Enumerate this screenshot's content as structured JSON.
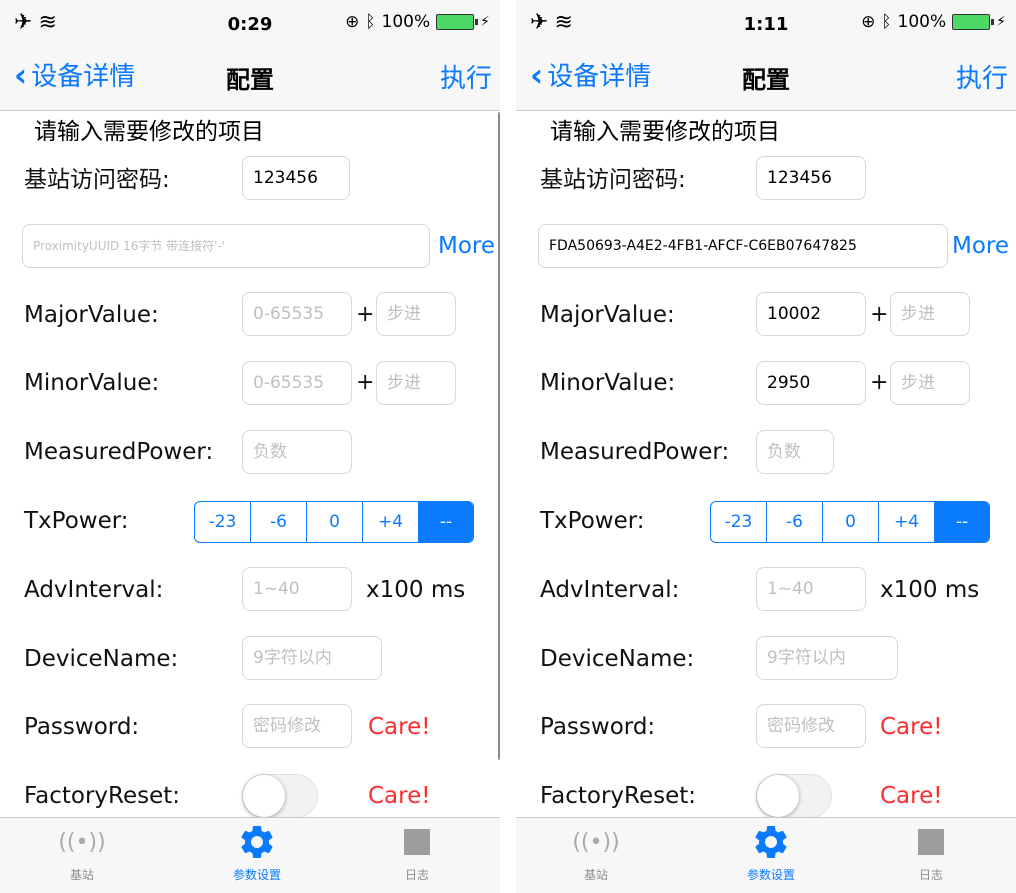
{
  "screens": [
    {
      "status": {
        "time": "0:29",
        "battery": "100%"
      },
      "nav": {
        "back": "设备详情",
        "title": "配置",
        "action": "执行"
      },
      "section_title": "请输入需要修改的项目",
      "password_label": "基站访问密码:",
      "password_value": "123456",
      "uuid_value": "",
      "uuid_placeholder": "ProximityUUID 16字节 带连接符'-'",
      "more": "More",
      "major_label": "MajorValue:",
      "major_value": "",
      "major_placeholder": "0-65535",
      "major_step_placeholder": "步进",
      "minor_label": "MinorValue:",
      "minor_value": "",
      "minor_placeholder": "0-65535",
      "minor_step_placeholder": "步进",
      "plus": "+",
      "measured_label": "MeasuredPower:",
      "measured_placeholder": "负数",
      "txpower_label": "TxPower:",
      "txpower_options": [
        "-23",
        "-6",
        "0",
        "+4",
        "--"
      ],
      "txpower_selected": "--",
      "adv_label": "AdvInterval:",
      "adv_placeholder": "1~40",
      "adv_suffix": "x100 ms",
      "devname_label": "DeviceName:",
      "devname_placeholder": "9字符以内",
      "pwd_label": "Password:",
      "pwd_placeholder": "密码修改",
      "care": "Care!",
      "reset_label": "FactoryReset:",
      "factory_reset_on": false,
      "tabs": [
        "基站",
        "参数设置",
        "日志"
      ],
      "active_tab": "参数设置"
    },
    {
      "status": {
        "time": "1:11",
        "battery": "100%"
      },
      "nav": {
        "back": "设备详情",
        "title": "配置",
        "action": "执行"
      },
      "section_title": "请输入需要修改的项目",
      "password_label": "基站访问密码:",
      "password_value": "123456",
      "uuid_value": "FDA50693-A4E2-4FB1-AFCF-C6EB07647825",
      "uuid_placeholder": "",
      "more": "More",
      "major_label": "MajorValue:",
      "major_value": "10002",
      "major_placeholder": "",
      "major_step_placeholder": "步进",
      "minor_label": "MinorValue:",
      "minor_value": "2950",
      "minor_placeholder": "",
      "minor_step_placeholder": "步进",
      "plus": "+",
      "measured_label": "MeasuredPower:",
      "measured_placeholder": "负数",
      "txpower_label": "TxPower:",
      "txpower_options": [
        "-23",
        "-6",
        "0",
        "+4",
        "--"
      ],
      "txpower_selected": "--",
      "adv_label": "AdvInterval:",
      "adv_placeholder": "1~40",
      "adv_suffix": "x100 ms",
      "devname_label": "DeviceName:",
      "devname_placeholder": "9字符以内",
      "pwd_label": "Password:",
      "pwd_placeholder": "密码修改",
      "care": "Care!",
      "reset_label": "FactoryReset:",
      "factory_reset_on": false,
      "tabs": [
        "基站",
        "参数设置",
        "日志"
      ],
      "active_tab": "参数设置"
    }
  ],
  "colors": {
    "accent": "#0a7aff",
    "warning": "#ff2d2d",
    "battery": "#4cd964"
  },
  "icons": [
    "airplane-icon",
    "wifi-icon",
    "alarm-icon",
    "bluetooth-icon",
    "battery-icon",
    "chevron-left-icon",
    "broadcast-icon",
    "gear-icon",
    "square-icon"
  ]
}
